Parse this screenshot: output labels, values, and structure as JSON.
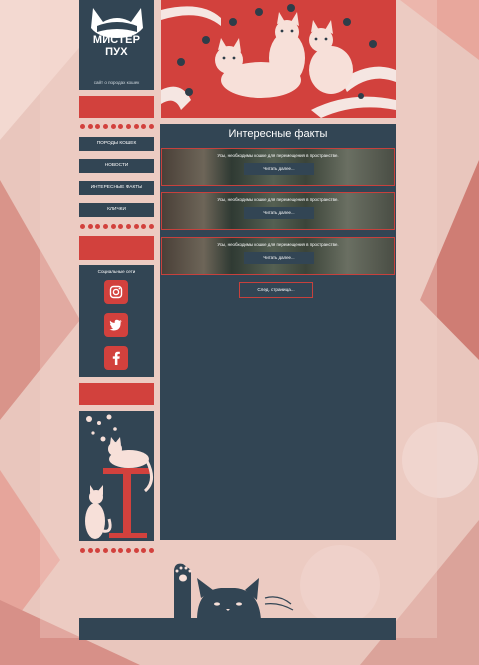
{
  "site": {
    "brand_line1": "МИСТЕР",
    "brand_line2": "ПУХ",
    "tagline": "сайт о породах кошек"
  },
  "nav": {
    "items": [
      {
        "label": "ПОРОДЫ КОШЕК"
      },
      {
        "label": "НОВОСТИ"
      },
      {
        "label": "ИНТЕРЕСНЫЕ ФАКТЫ"
      },
      {
        "label": "КЛИЧКИ"
      }
    ]
  },
  "social": {
    "title": "Социальные сети",
    "icons": [
      "instagram-icon",
      "twitter-icon",
      "facebook-icon"
    ]
  },
  "main": {
    "title": "Интересные факты",
    "cards": [
      {
        "text": "Усы, необходимы кошке для перемещения в пространстве.",
        "button": "Читать далее..."
      },
      {
        "text": "Усы, необходимы кошке для перемещения в пространстве.",
        "button": "Читать далее..."
      },
      {
        "text": "Усы, необходимы кошке для перемещения в пространстве.",
        "button": "Читать далее..."
      }
    ],
    "next_button": "След. страница..."
  },
  "colors": {
    "panel": "#324554",
    "accent": "#d2413d",
    "background": "#e9c6bd"
  }
}
